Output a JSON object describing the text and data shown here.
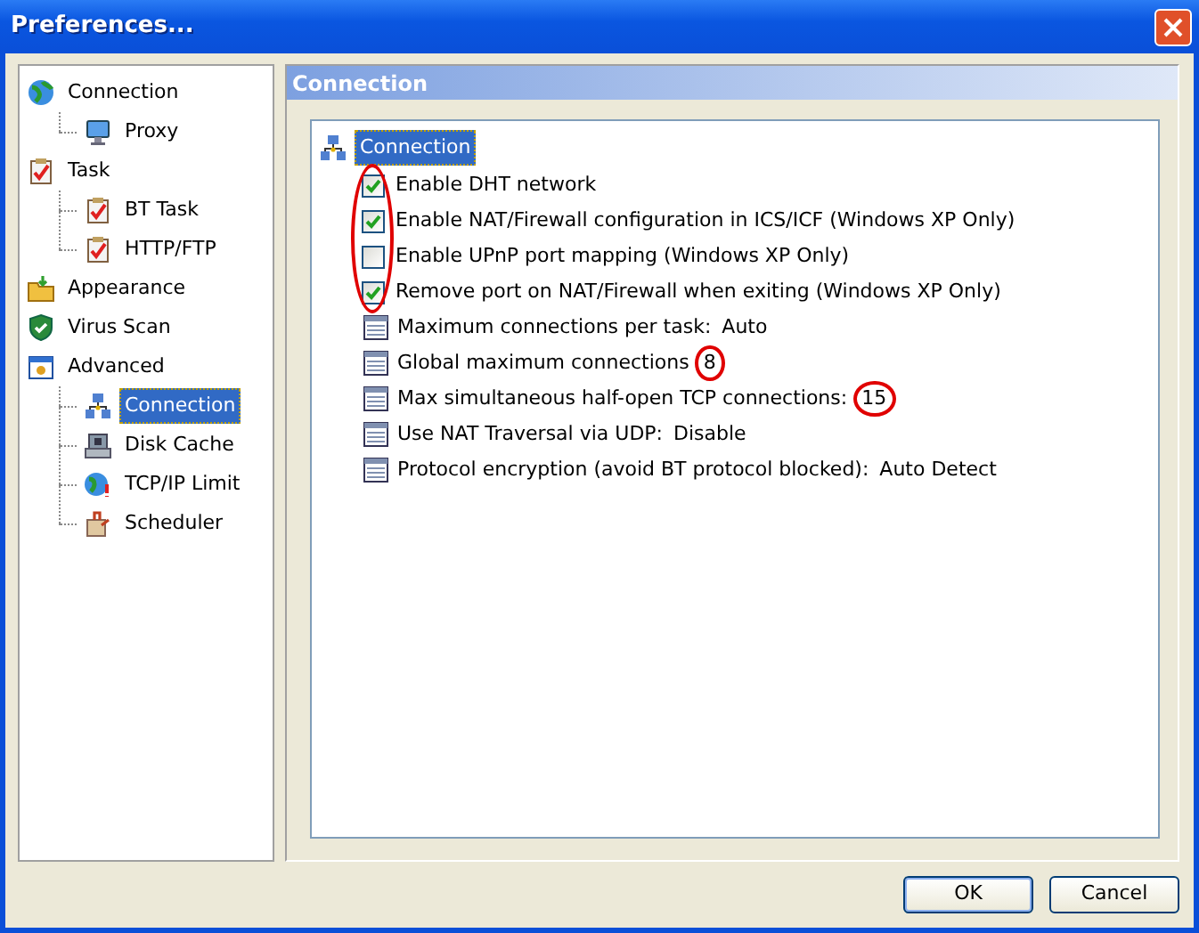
{
  "window": {
    "title": "Preferences..."
  },
  "sidebar": {
    "items": [
      {
        "label": "Connection",
        "selected": false,
        "children": [
          {
            "label": "Proxy",
            "selected": false
          }
        ]
      },
      {
        "label": "Task",
        "selected": false,
        "children": [
          {
            "label": "BT Task",
            "selected": false
          },
          {
            "label": "HTTP/FTP",
            "selected": false
          }
        ]
      },
      {
        "label": "Appearance",
        "selected": false
      },
      {
        "label": "Virus Scan",
        "selected": false
      },
      {
        "label": "Advanced",
        "selected": false,
        "children": [
          {
            "label": "Connection",
            "selected": true
          },
          {
            "label": "Disk Cache",
            "selected": false
          },
          {
            "label": "TCP/IP Limit",
            "selected": false
          },
          {
            "label": "Scheduler",
            "selected": false
          }
        ]
      }
    ]
  },
  "panel": {
    "title": "Connection",
    "root": {
      "label": "Connection",
      "selected": true
    },
    "checkboxes_circled": true,
    "settings": [
      {
        "kind": "checkbox",
        "label": "Enable DHT network",
        "checked": true
      },
      {
        "kind": "checkbox",
        "label": "Enable NAT/Firewall configuration in ICS/ICF (Windows XP Only)",
        "checked": true
      },
      {
        "kind": "checkbox",
        "label": "Enable UPnP port mapping (Windows XP Only)",
        "checked": false
      },
      {
        "kind": "checkbox",
        "label": "Remove port on NAT/Firewall when exiting (Windows XP Only)",
        "checked": true
      },
      {
        "kind": "option",
        "label": "Maximum connections per task:",
        "value": "Auto",
        "circled": false
      },
      {
        "kind": "option",
        "label": "Global maximum connections",
        "value": "8",
        "circled": true
      },
      {
        "kind": "option",
        "label": "Max simultaneous half-open TCP connections:",
        "value": "15",
        "circled": true
      },
      {
        "kind": "option",
        "label": "Use NAT Traversal via UDP:",
        "value": "Disable",
        "circled": false
      },
      {
        "kind": "option",
        "label": "Protocol encryption (avoid BT protocol blocked):",
        "value": "Auto Detect",
        "circled": false
      }
    ]
  },
  "buttons": [
    {
      "label": "OK",
      "default": true
    },
    {
      "label": "Cancel",
      "default": false
    }
  ]
}
